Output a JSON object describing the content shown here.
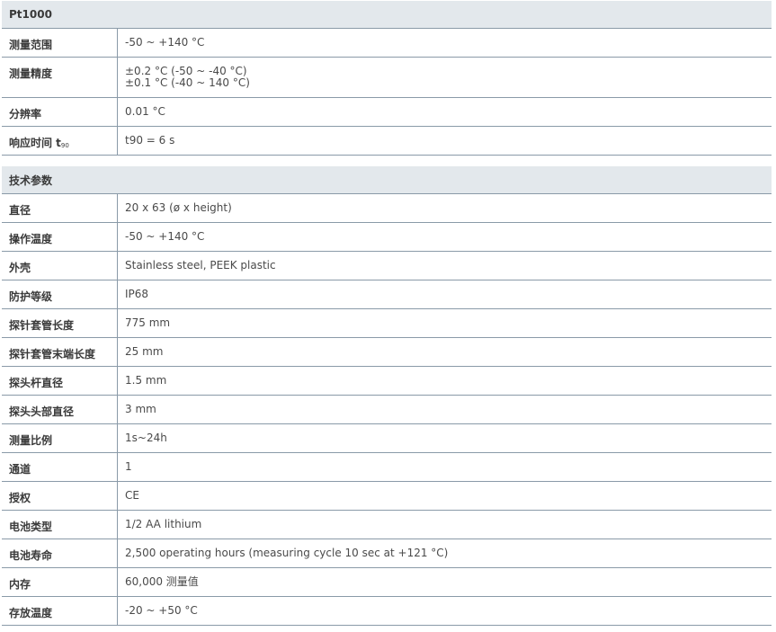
{
  "sensor_section": {
    "title": "Pt1000",
    "rows": [
      {
        "label": "测量范围",
        "value": "-50 ~ +140 °C"
      },
      {
        "label": "测量精度",
        "value_lines": [
          "±0.2 °C (-50 ~ -40 °C)",
          "±0.1 °C (-40 ~ 140 °C)"
        ]
      },
      {
        "label": "分辨率",
        "value": "0.01 °C"
      },
      {
        "label_main": "响应时间 t",
        "label_sub": "90",
        "value": "t90 = 6 s"
      }
    ]
  },
  "tech_section": {
    "title": "技术参数",
    "rows": [
      {
        "label": "直径",
        "value": "20 x 63 (ø x height)"
      },
      {
        "label": "操作温度",
        "value": "-50 ~ +140 °C"
      },
      {
        "label": "外壳",
        "value": "Stainless steel, PEEK plastic"
      },
      {
        "label": "防护等级",
        "value": "IP68"
      },
      {
        "label": "探针套管长度",
        "value": "775 mm"
      },
      {
        "label": "探针套管末端长度",
        "value": "25 mm"
      },
      {
        "label": "探头杆直径",
        "value": "1.5 mm"
      },
      {
        "label": "探头头部直径",
        "value": "3 mm"
      },
      {
        "label": "测量比例",
        "value": "1s~24h"
      },
      {
        "label": "通道",
        "value": "1"
      },
      {
        "label": "授权",
        "value": "CE"
      },
      {
        "label": "电池类型",
        "value": "1/2 AA lithium"
      },
      {
        "label": "电池寿命",
        "value": "2,500 operating hours (measuring cycle 10 sec at +121 °C)"
      },
      {
        "label": "内存",
        "value": "60,000 测量值"
      },
      {
        "label": "存放温度",
        "value": "-20 ~ +50 °C"
      }
    ]
  }
}
